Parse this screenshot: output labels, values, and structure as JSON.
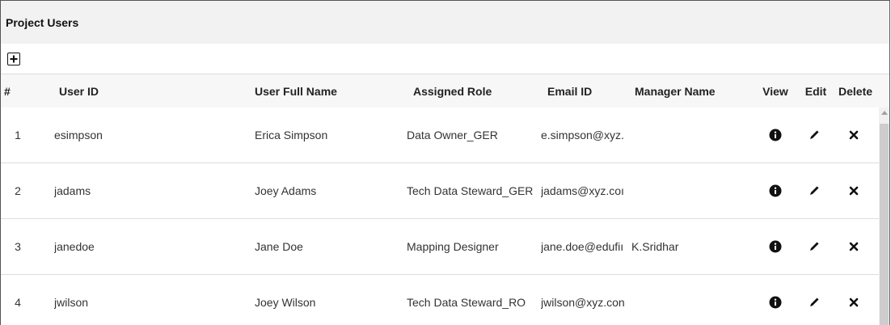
{
  "panel": {
    "title": "Project Users"
  },
  "toolbar": {
    "add_icon": "plus-square-icon"
  },
  "table": {
    "headers": {
      "num": "#",
      "user_id": "User ID",
      "full_name": "User Full Name",
      "role": "Assigned Role",
      "email": "Email ID",
      "manager": "Manager Name",
      "view": "View",
      "edit": "Edit",
      "delete": "Delete"
    },
    "rows": [
      {
        "num": "1",
        "user_id": "esimpson",
        "full_name": "Erica Simpson",
        "role": "Data Owner_GER",
        "email": "e.simpson@xyz.",
        "manager": ""
      },
      {
        "num": "2",
        "user_id": "jadams",
        "full_name": "Joey Adams",
        "role": "Tech Data Steward_GER",
        "email": "jadams@xyz.coı",
        "manager": ""
      },
      {
        "num": "3",
        "user_id": "janedoe",
        "full_name": "Jane Doe",
        "role": "Mapping Designer",
        "email": "jane.doe@edufiı",
        "manager": "K.Sridhar"
      },
      {
        "num": "4",
        "user_id": "jwilson",
        "full_name": "Joey Wilson",
        "role": "Tech Data Steward_RO",
        "email": "jwilson@xyz.con",
        "manager": ""
      }
    ],
    "row_icons": {
      "view": "info-circle-icon",
      "edit": "pencil-icon",
      "delete": "close-x-icon"
    }
  }
}
